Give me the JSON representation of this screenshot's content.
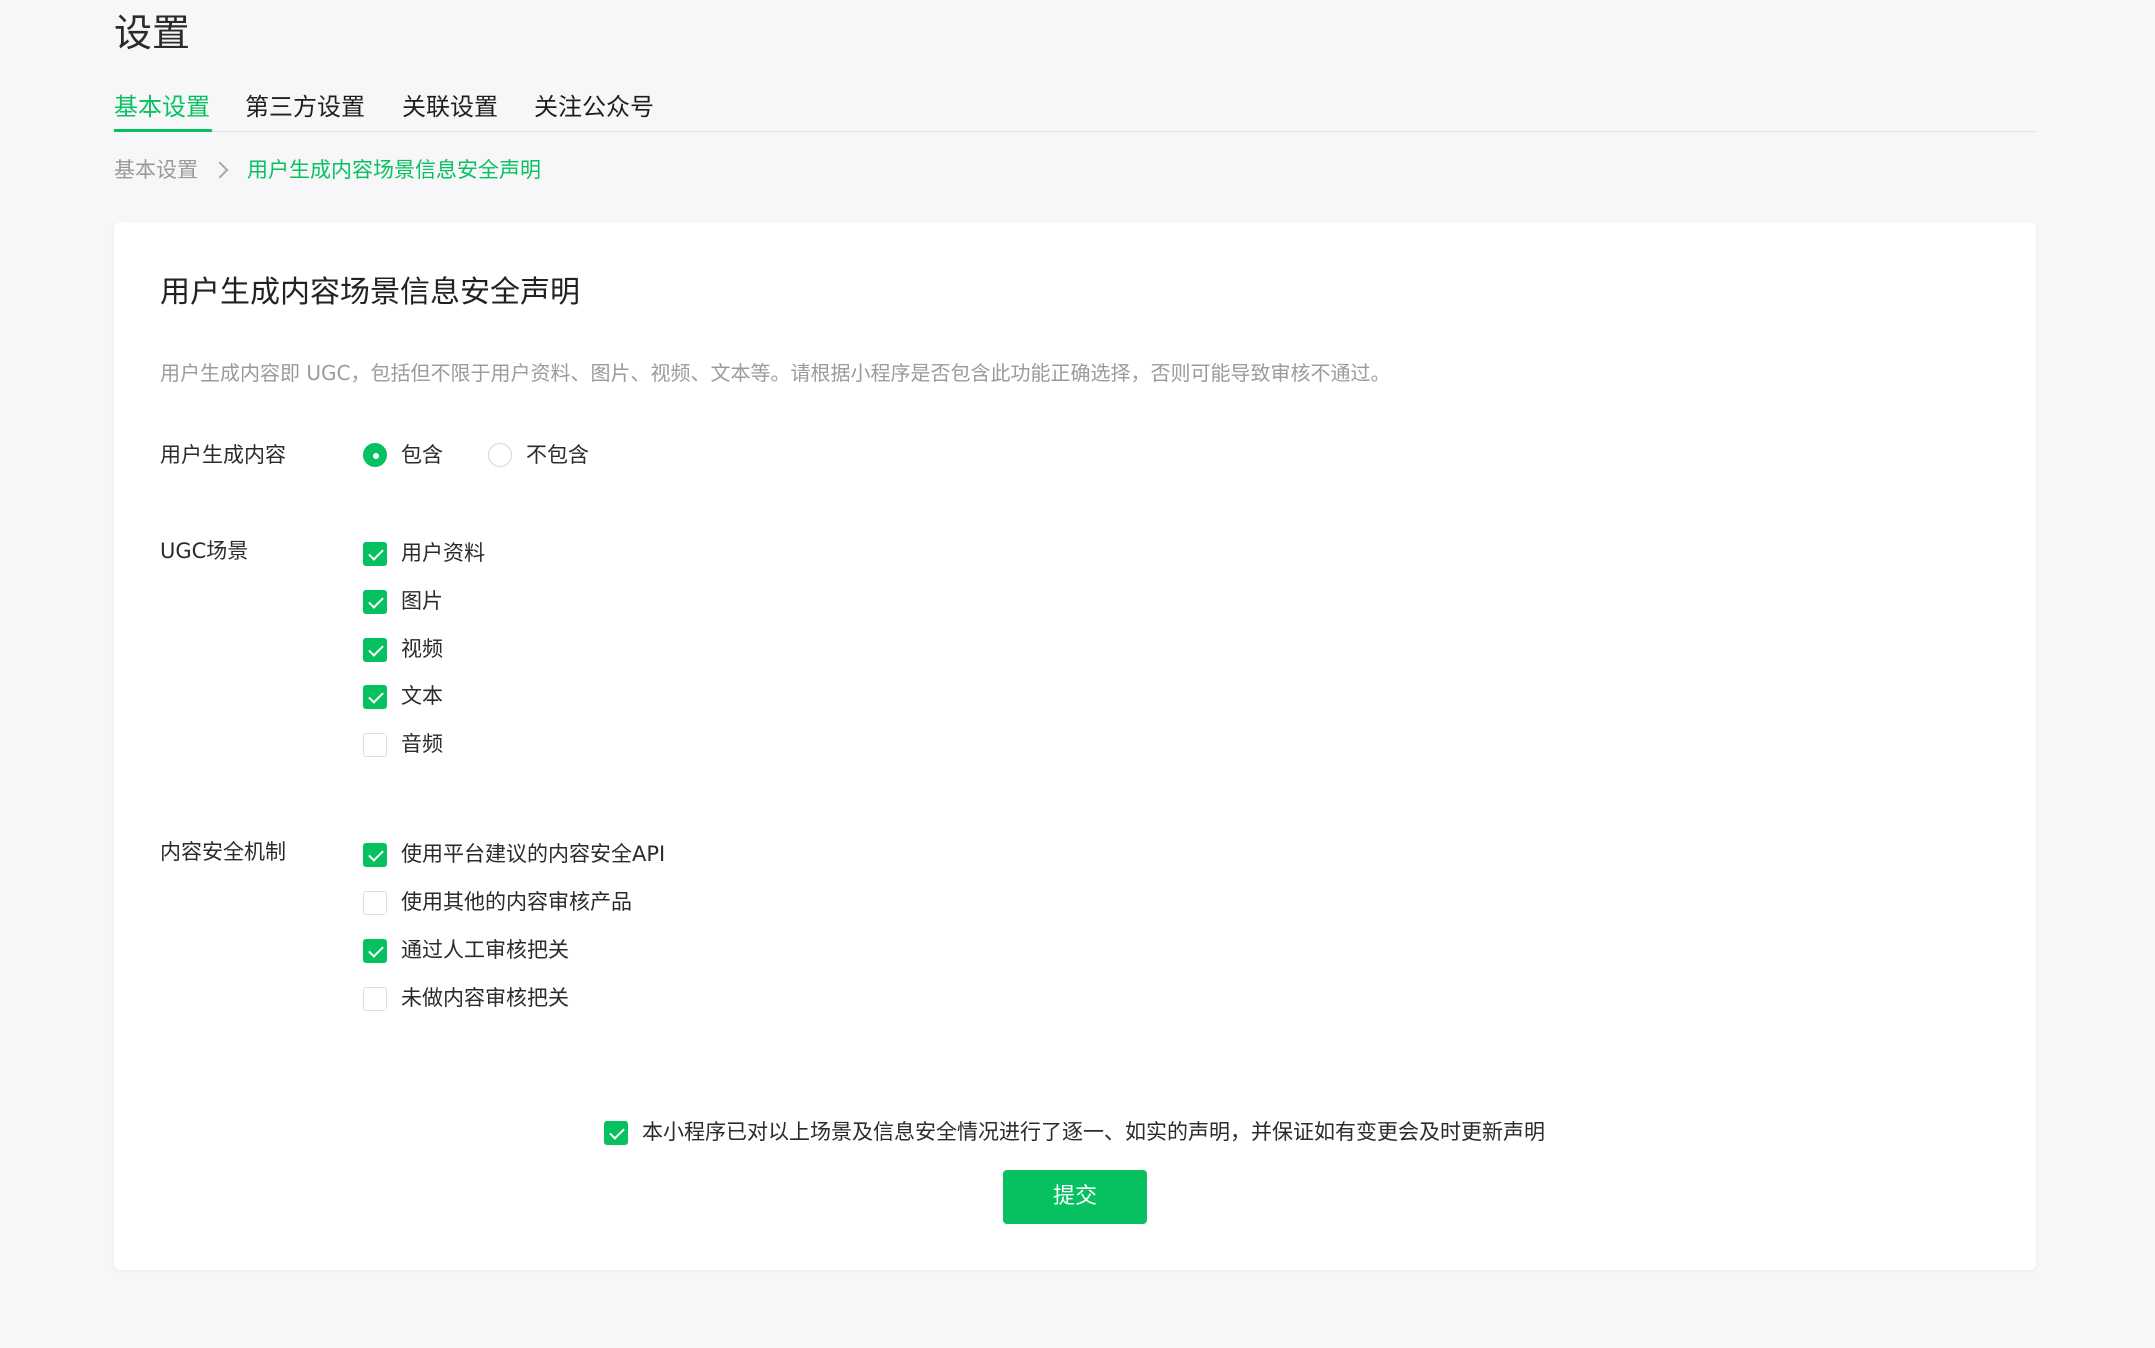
{
  "page": {
    "title": "设置"
  },
  "tabs": [
    {
      "label": "基本设置",
      "active": true
    },
    {
      "label": "第三方设置",
      "active": false
    },
    {
      "label": "关联设置",
      "active": false
    },
    {
      "label": "关注公众号",
      "active": false
    }
  ],
  "breadcrumb": {
    "root": "基本设置",
    "separator_icon": "chevron-right-icon",
    "current": "用户生成内容场景信息安全声明"
  },
  "card": {
    "title": "用户生成内容场景信息安全声明",
    "description": "用户生成内容即 UGC，包括但不限于用户资料、图片、视频、文本等。请根据小程序是否包含此功能正确选择，否则可能导致审核不通过。"
  },
  "ugc_content": {
    "label": "用户生成内容",
    "options": [
      {
        "label": "包含",
        "selected": true
      },
      {
        "label": "不包含",
        "selected": false
      }
    ]
  },
  "ugc_scenes": {
    "label": "UGC场景",
    "options": [
      {
        "label": "用户资料",
        "checked": true
      },
      {
        "label": "图片",
        "checked": true
      },
      {
        "label": "视频",
        "checked": true
      },
      {
        "label": "文本",
        "checked": true
      },
      {
        "label": "音频",
        "checked": false
      }
    ]
  },
  "security_mechanism": {
    "label": "内容安全机制",
    "options": [
      {
        "label": "使用平台建议的内容安全API",
        "checked": true
      },
      {
        "label": "使用其他的内容审核产品",
        "checked": false
      },
      {
        "label": "通过人工审核把关",
        "checked": true
      },
      {
        "label": "未做内容审核把关",
        "checked": false
      }
    ]
  },
  "declaration": {
    "label": "本小程序已对以上场景及信息安全情况进行了逐一、如实的声明，并保证如有变更会及时更新声明",
    "checked": true
  },
  "submit": {
    "label": "提交"
  },
  "colors": {
    "accent": "#07c160",
    "background": "#f7f7f9",
    "card": "#ffffff",
    "muted_text": "#9b9b9b"
  }
}
